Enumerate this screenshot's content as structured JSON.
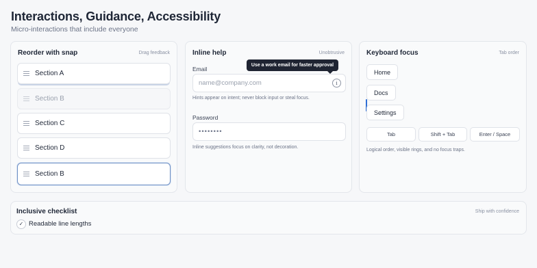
{
  "header": {
    "title": "Interactions, Guidance, Accessibility",
    "subtitle": "Micro-interactions that include everyone"
  },
  "reorder": {
    "title": "Reorder with snap",
    "hint": "Drag feedback",
    "rows": [
      {
        "label": "Section A",
        "state": "lifted"
      },
      {
        "label": "Section B",
        "state": "ghost"
      },
      {
        "label": "Section C",
        "state": "normal"
      },
      {
        "label": "Section D",
        "state": "normal"
      },
      {
        "label": "Section B",
        "state": "active"
      }
    ]
  },
  "inline_help": {
    "title": "Inline help",
    "hint": "Unobtrusive",
    "email_label": "Email",
    "email_placeholder": "name@company.com",
    "email_value": "",
    "tooltip": "Use a work email for faster approval",
    "info_glyph": "i",
    "email_help": "Hints appear on intent; never block input or steal focus.",
    "password_label": "Password",
    "password_value": "••••••••",
    "password_help": "Inline suggestions focus on clarity, not decoration."
  },
  "keyboard": {
    "title": "Keyboard focus",
    "hint": "Tab order",
    "buttons": [
      "Home",
      "Docs",
      "Settings"
    ],
    "keys": [
      "Tab",
      "Shift + Tab",
      "Enter / Space"
    ],
    "note": "Logical order, visible rings, and no focus traps.",
    "focus_ring_color": "#2f6fd6"
  },
  "checklist": {
    "title": "Inclusive checklist",
    "hint": "Ship with confidence",
    "items": [
      {
        "label": "Readable line lengths",
        "checked": true,
        "glyph": "✓"
      }
    ]
  },
  "colors": {
    "background": "#f6f7f9",
    "accent": "#2f6fd6",
    "tooltip_bg": "#1f2432"
  }
}
